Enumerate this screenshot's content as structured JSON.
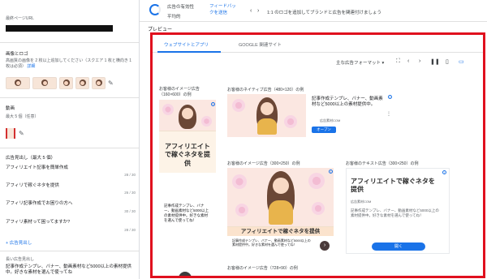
{
  "left": {
    "final_url_label": "最終ページURL",
    "images_heading": "画像とロゴ",
    "images_desc": "高画質の画像を 2 枚以上追加してください（スクエア 1 枚と横向き 1 枚は必須）",
    "images_desc2": "1 枚は必須）",
    "images_link": "詳細",
    "video_heading": "動画",
    "video_desc": "最大 5 個（任意）",
    "headlines_heading": "広告見出し（最大 5 個）",
    "headlines": [
      {
        "text": "アフィリエイト記事を簡単作成",
        "count": "28 / 30"
      },
      {
        "text": "アフィリで稼ぐネタを提供",
        "count": "26 / 30"
      },
      {
        "text": "アフィリ記事作成でお困りの方へ",
        "count": "30 / 30"
      },
      {
        "text": "アフィリ素材って困ってますか?",
        "count": "28 / 30"
      }
    ],
    "add_headline": "+ 広告見出し",
    "long_headline_label": "長い広告見出し",
    "long_headline_value": "記事作成テンプレ、バナー、動画素材など5000以上の素材提供",
    "long_headline_value2": "中。好きな素材を選んで使ってね"
  },
  "topbar": {
    "strength_label": "広告の有効性",
    "strength_value": "平均的",
    "feedback_link": "フィードバックを送信",
    "feedback_link2": "信",
    "pagination": "1:1 のロゴを追加してブランドと広告を関連付けましょう"
  },
  "preview": {
    "label": "プレビュー",
    "tabs": [
      "ウェブサイトとアプリ",
      "GOOGLE 関連サイト"
    ],
    "format_select": "主な広告フォーマット",
    "ads": {
      "image_160x600_label": "お客様のイメージ広告（160×600）の例",
      "native_480x120_label": "お客様のネイティブ広告（480×120）の例",
      "native_text": "記事作成テンプレ、バナー、動画素材など5000以上の素材提供中。",
      "native_meta": "広告素材COM",
      "native_button": "オープン",
      "skyscraper_banner": "アフィリエイトで稼ぐネタを提供",
      "skyscraper_body": "記事作成テンプレ、バナー、動画素材など5000以上の素材提供中。好きな素材を選んで使ってね！",
      "image_300x250_label": "お客様のイメージ広告（300×250）の例",
      "image_banner": "アフィリエイトで稼ぐネタを提供",
      "image_body": "記事作成テンプレ、バナー、動画素材など5000以上の素材提供中。好きな素材を選んで使ってね！",
      "text_300x250_label": "お客様のテキスト広告（300×250）の例",
      "text_headline": "アフィリエイトで稼ぐネタを提供",
      "text_meta": "広告素材COM",
      "text_body": "記事作成テンプレ、バナー、動画素材など5000以上の素材提供中。好きな素材を選んで使ってね！",
      "text_button": "開く",
      "image_728x90_label": "お客様のイメージ広告（728×90）の例"
    }
  },
  "colors": {
    "accent": "#1a73e8",
    "highlight_border": "#e0101e"
  }
}
